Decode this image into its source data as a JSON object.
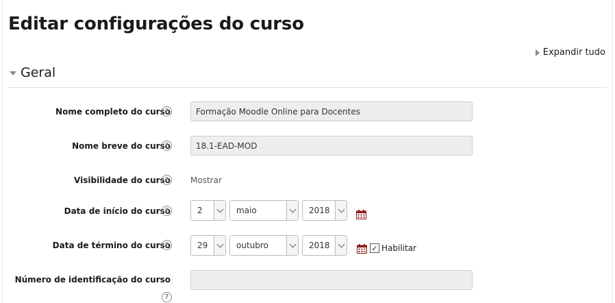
{
  "page": {
    "title": "Editar configurações do curso"
  },
  "expand_all": {
    "label": "Expandir tudo"
  },
  "section": {
    "title": "Geral"
  },
  "fields": {
    "fullname": {
      "label": "Nome completo do curso",
      "value": "Formação Moodle Online para Docentes"
    },
    "shortname": {
      "label": "Nome breve do curso",
      "value": "18.1-EAD-MOD"
    },
    "visibility": {
      "label": "Visibilidade do curso",
      "value": "Mostrar"
    },
    "startdate": {
      "label": "Data de início do curso",
      "day": "2",
      "month": "maio",
      "year": "2018"
    },
    "enddate": {
      "label": "Data de término do curso",
      "day": "29",
      "month": "outubro",
      "year": "2018",
      "enable_label": "Habilitar",
      "enabled": true
    },
    "idnumber": {
      "label": "Número de identificação do curso",
      "value": ""
    }
  },
  "icons": {
    "help": "help-circle-icon",
    "calendar": "calendar-icon",
    "expand": "triangle-right-icon",
    "collapse": "triangle-down-icon",
    "dropdown": "chevron-down-icon"
  },
  "colors": {
    "calendar": "#8b1a1a",
    "input_bg": "#eeeeee"
  }
}
